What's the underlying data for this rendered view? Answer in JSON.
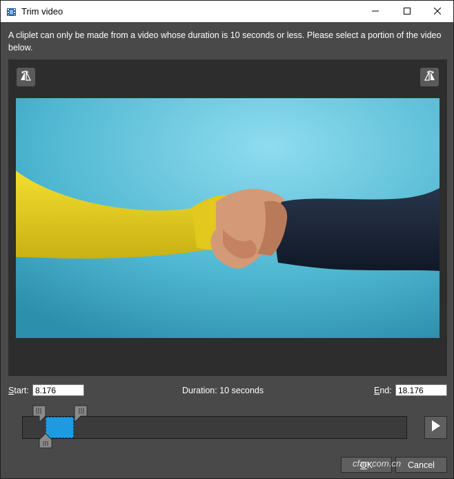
{
  "window": {
    "title": "Trim video",
    "minimize_glyph": "—",
    "maximize_glyph": "☐",
    "close_glyph": "✕"
  },
  "instruction": "A cliplet can only be made from a video whose duration is 10 seconds or less. Please select a portion of the video below.",
  "trim": {
    "start_prefix": "S",
    "start_rest": "tart:",
    "start_value": "8.176",
    "duration_text": "Duration: 10 seconds",
    "end_prefix": "E",
    "end_rest": "nd:",
    "end_value": "18.176"
  },
  "buttons": {
    "ok_prefix": "O",
    "ok_rest": "K",
    "cancel": "Cancel"
  },
  "icons": {
    "app": "film-icon",
    "rotate_left": "rotate-left-icon",
    "rotate_right": "rotate-right-icon",
    "play": "play-icon"
  },
  "colors": {
    "selection": "#1e9be0",
    "panel": "#2d2d2d",
    "background": "#494949"
  },
  "watermark": "cfan.com.cn"
}
